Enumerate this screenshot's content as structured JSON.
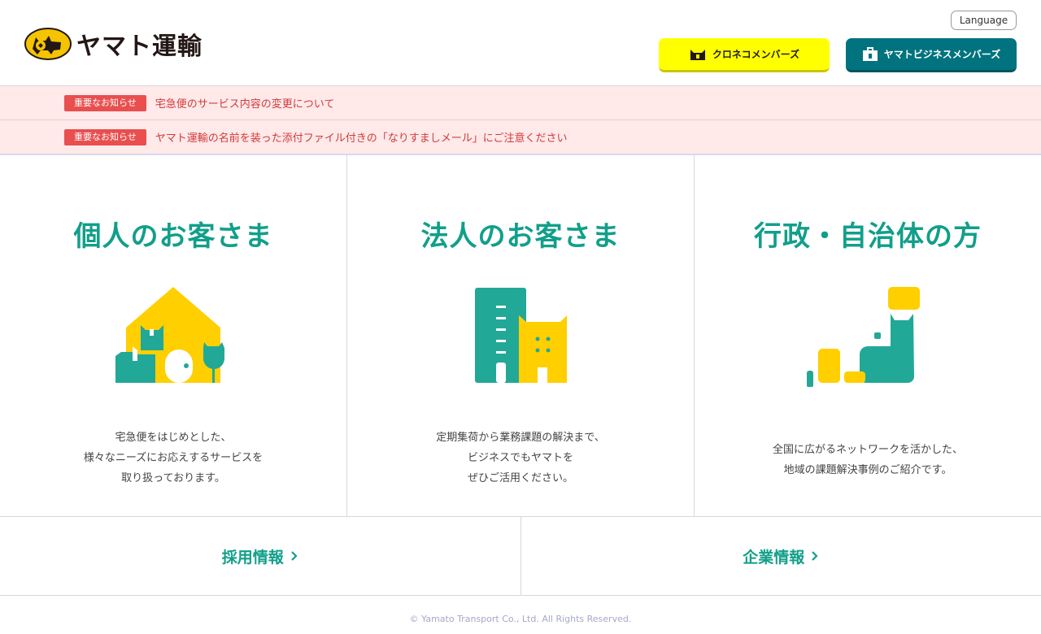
{
  "brand": {
    "name": "ヤマト運輸",
    "accent": "#119f8a",
    "yellow": "#ffff00",
    "teal": "#00737e"
  },
  "header": {
    "language_label": "Language",
    "kuroneko_label": "クロネコメンバーズ",
    "business_label": "ヤマトビジネスメンバーズ"
  },
  "notices": [
    {
      "badge": "重要なお知らせ",
      "text": "宅急便のサービス内容の変更について"
    },
    {
      "badge": "重要なお知らせ",
      "text": "ヤマト運輸の名前を装った添付ファイル付きの「なりすましメール」にご注意ください"
    }
  ],
  "cards": [
    {
      "title": "個人のお客さま",
      "icon": "house-cats-icon",
      "desc": [
        "宅急便をはじめとした、",
        "様々なニーズにお応えするサービスを",
        "取り扱っております。"
      ]
    },
    {
      "title": "法人のお客さま",
      "icon": "building-cat-icon",
      "desc": [
        "定期集荷から業務課題の解決まで、",
        "ビジネスでもヤマトを",
        "ぜひご活用ください。"
      ]
    },
    {
      "title": "行政・自治体の方",
      "icon": "network-cat-icon",
      "desc": [
        "全国に広がるネットワークを活かした、",
        "地域の課題解決事例のご紹介です。"
      ]
    }
  ],
  "links": [
    {
      "label": "採用情報"
    },
    {
      "label": "企業情報"
    }
  ],
  "footer": {
    "copyright": "© Yamato Transport Co., Ltd. All Rights Reserved."
  }
}
